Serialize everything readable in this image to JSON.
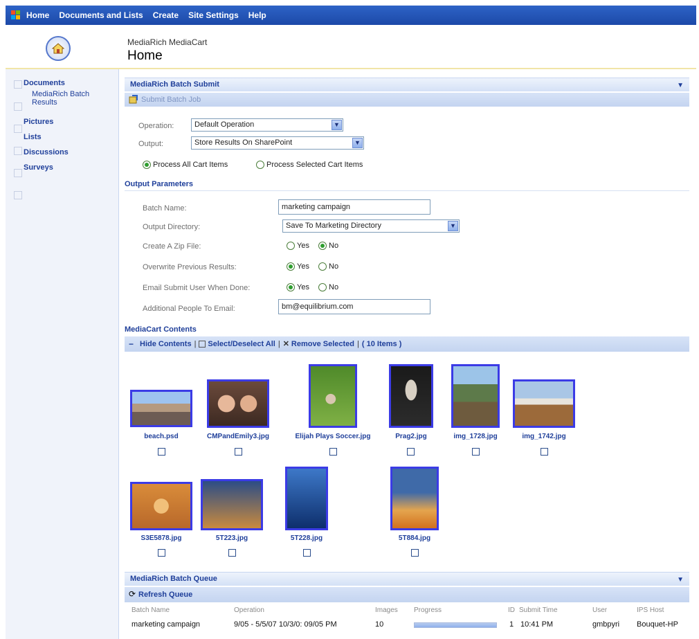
{
  "nav": {
    "items": [
      "Home",
      "Documents and Lists",
      "Create",
      "Site Settings",
      "Help"
    ]
  },
  "header": {
    "subtitle": "MediaRich MediaCart",
    "title": "Home"
  },
  "sidebar": {
    "sections": [
      "Documents",
      "Pictures",
      "Lists",
      "Discussions",
      "Surveys"
    ],
    "sub_item": "MediaRich Batch Results"
  },
  "batch_submit": {
    "title": "MediaRich Batch Submit",
    "submit_label": "Submit Batch Job",
    "operation_label": "Operation:",
    "operation_value": "Default Operation",
    "output_label": "Output:",
    "output_value": "Store Results On SharePoint",
    "process_all": "Process All Cart Items",
    "process_selected": "Process Selected Cart Items"
  },
  "output_params": {
    "title": "Output Parameters",
    "batch_name_label": "Batch Name:",
    "batch_name_value": "marketing campaign",
    "output_dir_label": "Output Directory:",
    "output_dir_value": "Save To Marketing Directory",
    "zip_label": "Create A Zip File:",
    "overwrite_label": "Overwrite Previous Results:",
    "email_label": "Email Submit User When Done:",
    "people_label": "Additional People To Email:",
    "people_value": "bm@equilibrium.com",
    "yes": "Yes",
    "no": "No"
  },
  "cart": {
    "title": "MediaCart Contents",
    "hide": "Hide Contents",
    "select_all": "Select/Deselect All",
    "remove": "Remove Selected",
    "count": "( 10 Items )",
    "files": [
      "beach.psd",
      "CMPandEmily3.jpg",
      "Elijah Plays Soccer.jpg",
      "Prag2.jpg",
      "img_1728.jpg",
      "img_1742.jpg",
      "S3E5878.jpg",
      "5T223.jpg",
      "5T228.jpg",
      "5T884.jpg"
    ]
  },
  "queue": {
    "title": "MediaRich Batch Queue",
    "refresh": "Refresh Queue",
    "headers": [
      "Batch Name",
      "Operation",
      "Images",
      "Progress",
      "ID",
      "Submit Time",
      "User",
      "IPS Host"
    ],
    "row": {
      "batch_name": "marketing campaign",
      "operation": "9/05 - 5/5/07 10/3/0: 09/05 PM",
      "images": "10",
      "progress": 1.0,
      "id": "1",
      "submit_time": "10:41 PM",
      "user": "gmbpyri",
      "host": "Bouquet-HP"
    }
  },
  "colors": {
    "topbar": "#2e63c6",
    "link": "#1f3f9a",
    "thumb_border": "#3b3be6"
  }
}
